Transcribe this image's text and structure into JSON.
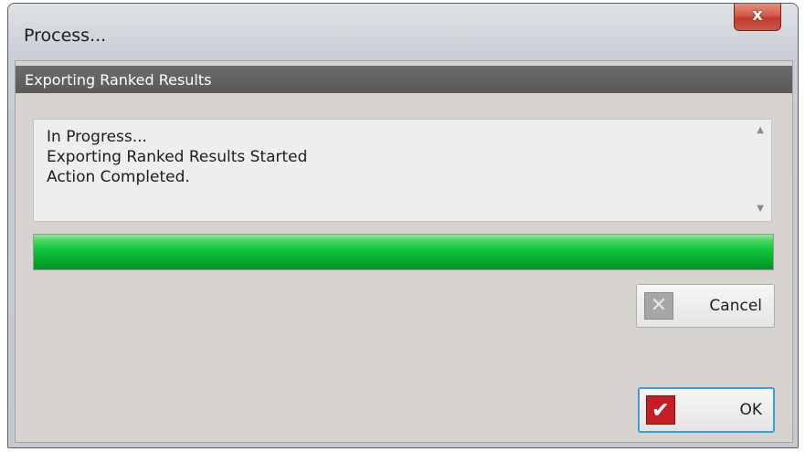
{
  "window": {
    "title": "Process...",
    "close_glyph": "x"
  },
  "header": {
    "title": "Exporting Ranked Results"
  },
  "log": {
    "lines": [
      "In Progress...",
      "Exporting Ranked Results Started",
      "Action Completed."
    ]
  },
  "progress": {
    "value_percent": 100,
    "color": "#0fc43a"
  },
  "buttons": {
    "cancel_label": "Cancel",
    "cancel_icon": "x-icon",
    "ok_label": "OK",
    "ok_icon": "checkmark-icon"
  },
  "colors": {
    "header_band": "#5f5f5f",
    "ok_icon_bg": "#c41e24",
    "close_button": "#c9594a"
  }
}
